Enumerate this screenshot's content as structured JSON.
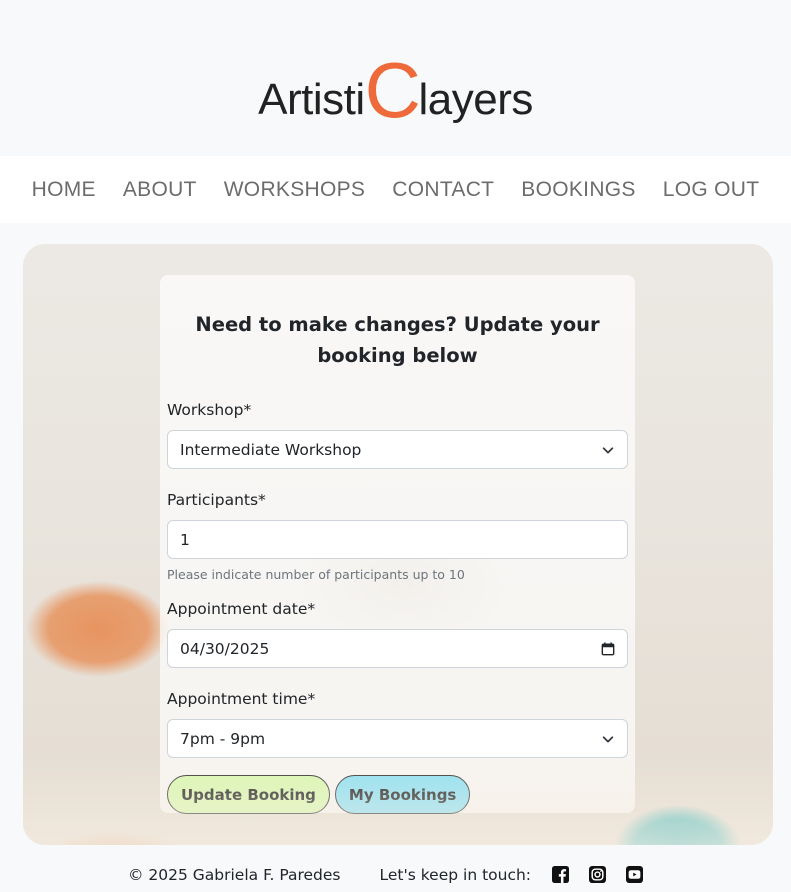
{
  "brand": {
    "before": "Artisti",
    "big_letter": "C",
    "after": "layers",
    "accent": "#ee6a3a"
  },
  "nav": [
    {
      "label": "HOME"
    },
    {
      "label": "ABOUT"
    },
    {
      "label": "WORKSHOPS"
    },
    {
      "label": "CONTACT"
    },
    {
      "label": "BOOKINGS"
    },
    {
      "label": "LOG OUT"
    }
  ],
  "form": {
    "heading": "Need to make changes? Update your booking below",
    "workshop": {
      "label": "Workshop*",
      "value": "Intermediate Workshop",
      "icon": "chevron-down-icon"
    },
    "participants": {
      "label": "Participants*",
      "value": "1",
      "help": "Please indicate number of participants up to 10"
    },
    "date": {
      "label": "Appointment date*",
      "value": "04/30/2025",
      "icon": "calendar-icon"
    },
    "time": {
      "label": "Appointment time*",
      "value": "7pm - 9pm",
      "icon": "chevron-down-icon"
    },
    "update_button": "Update Booking",
    "bookings_button": "My Bookings"
  },
  "footer": {
    "copyright": "© 2025 Gabriela F. Paredes",
    "social_label": "Let's keep in touch:",
    "social_icons": [
      "facebook-icon",
      "instagram-icon",
      "youtube-icon"
    ]
  }
}
